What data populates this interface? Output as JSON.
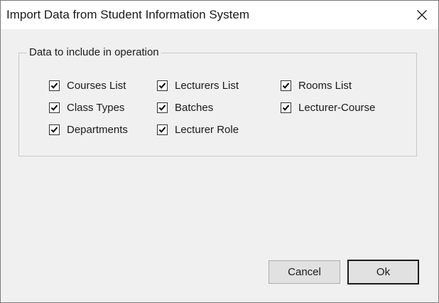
{
  "window": {
    "title": "Import Data from Student Information System",
    "close_icon": "close-icon"
  },
  "group": {
    "legend": "Data to include in operation",
    "checkboxes": [
      {
        "label": "Courses List",
        "checked": true
      },
      {
        "label": "Class Types",
        "checked": true
      },
      {
        "label": "Departments",
        "checked": true
      },
      {
        "label": "Lecturers List",
        "checked": true
      },
      {
        "label": "Batches",
        "checked": true
      },
      {
        "label": "Lecturer Role",
        "checked": true
      },
      {
        "label": "Rooms List",
        "checked": true
      },
      {
        "label": "Lecturer-Course",
        "checked": true
      }
    ]
  },
  "buttons": {
    "cancel_label": "Cancel",
    "ok_label": "Ok"
  }
}
